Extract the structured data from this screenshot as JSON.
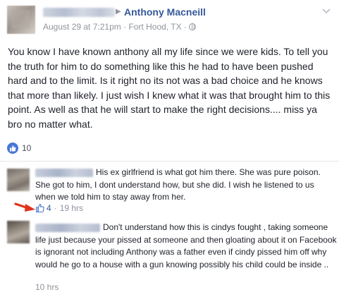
{
  "post": {
    "recipient": "Anthony Macneill",
    "meta": {
      "date": "August 29 at 7:21pm",
      "separator": "·",
      "location": "Fort Hood, TX",
      "separator2": "·"
    },
    "text": "You know I have known anthony all my life since we were kids. To tell you the truth for him to do something like this he had to have been pushed hard and to the limit. Is it right no its not was a bad choice and he knows that more than likely. I just wish I knew what it was that brought him to this point. As well as that he will start to make the right decisions.... miss ya bro no matter what.",
    "reactions": {
      "like_count": "10"
    }
  },
  "comments": [
    {
      "text": "His ex girlfriend is what got him there. She was pure poison. She got to him, I dont understand how, but she did. I wish he listened to us when we told him to stay away from her.",
      "likes": "4",
      "separator": "·",
      "time": "19 hrs"
    },
    {
      "text": "Don't understand how this is cindys fought , taking someone life just because your pissed at someone and then gloating about it on Facebook is ignorant not including Anthony was a father even if cindy pissed him off why would he go to a house with a gun knowing possibly his child could be inside ..",
      "time": "10 hrs"
    }
  ],
  "icons": {
    "header_arrow": "right-triangle-icon",
    "privacy": "globe-icon",
    "menu": "chevron-down-icon",
    "reaction": "like-icon",
    "comment_like": "thumbs-up-icon",
    "annotation": "red-arrow-icon"
  },
  "colors": {
    "link": "#365899",
    "meta": "#90949c",
    "like_blue": "#4a76d4",
    "annotation_red": "#e0331c"
  }
}
